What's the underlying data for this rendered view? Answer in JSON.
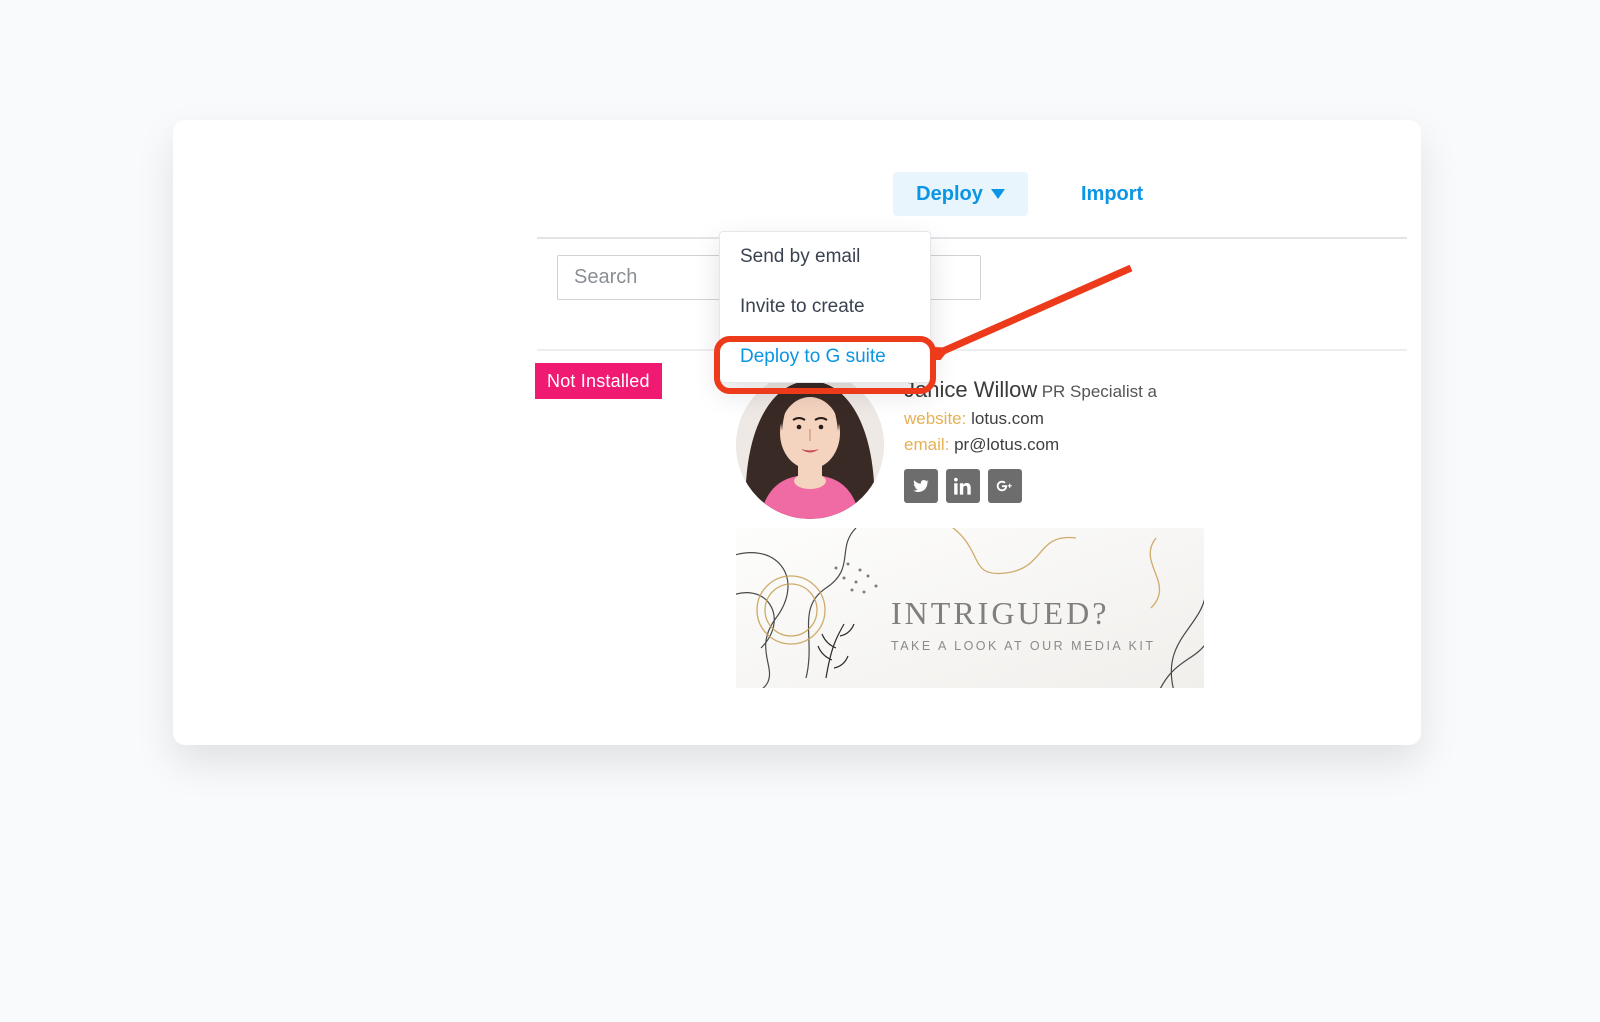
{
  "toolbar": {
    "deploy_label": "Deploy",
    "import_label": "Import"
  },
  "search": {
    "placeholder": "Search"
  },
  "badge": {
    "not_installed_label": "Not Installed"
  },
  "dropdown": {
    "items": [
      {
        "label": "Send by email"
      },
      {
        "label": "Invite to create"
      },
      {
        "label": "Deploy to G suite"
      }
    ],
    "highlight_index": 2
  },
  "signature": {
    "name": "Janice Willow",
    "title": "PR Specialist a",
    "website_key": "website:",
    "website_value": "lotus.com",
    "email_key": "email:",
    "email_value": "pr@lotus.com",
    "banner_headline": "INTRIGUED?",
    "banner_sub": "TAKE A LOOK AT OUR MEDIA KIT",
    "social": {
      "twitter": "twitter-icon",
      "linkedin": "linkedin-icon",
      "googleplus": "googleplus-icon"
    }
  },
  "colors": {
    "accent": "#0b95e5",
    "orange": "#ec3a1a",
    "pink": "#f11a72",
    "gold": "#e5b154"
  }
}
